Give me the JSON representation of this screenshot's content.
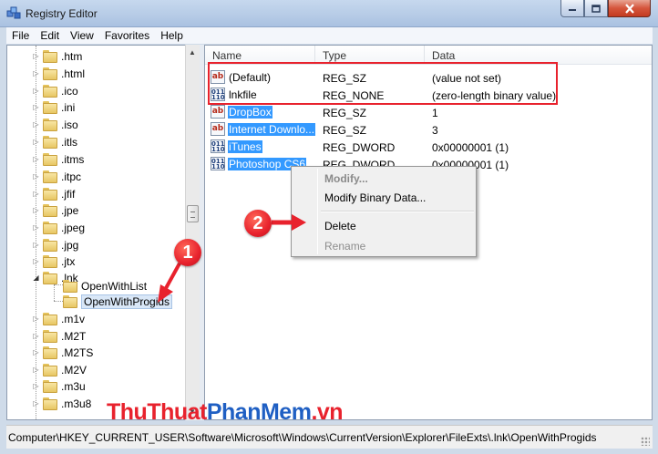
{
  "window": {
    "title": "Registry Editor"
  },
  "menu": [
    "File",
    "Edit",
    "View",
    "Favorites",
    "Help"
  ],
  "tree": {
    "items": [
      {
        "label": ".htm"
      },
      {
        "label": ".html"
      },
      {
        "label": ".ico"
      },
      {
        "label": ".ini"
      },
      {
        "label": ".iso"
      },
      {
        "label": ".itls"
      },
      {
        "label": ".itms"
      },
      {
        "label": ".itpc"
      },
      {
        "label": ".jfif"
      },
      {
        "label": ".jpe"
      },
      {
        "label": ".jpeg"
      },
      {
        "label": ".jpg"
      },
      {
        "label": ".jtx"
      },
      {
        "label": ".lnk"
      }
    ],
    "children": [
      {
        "label": "OpenWithList"
      },
      {
        "label": "OpenWithProgids"
      }
    ],
    "items_after": [
      {
        "label": ".m1v"
      },
      {
        "label": ".M2T"
      },
      {
        "label": ".M2TS"
      },
      {
        "label": ".M2V"
      },
      {
        "label": ".m3u"
      },
      {
        "label": ".m3u8"
      }
    ]
  },
  "list": {
    "headers": [
      "Name",
      "Type",
      "Data"
    ],
    "rows": [
      {
        "name": "(Default)",
        "type": "REG_SZ",
        "data": "(value not set)",
        "icon": "ab"
      },
      {
        "name": "lnkfile",
        "type": "REG_NONE",
        "data": "(zero-length binary value)",
        "icon": "bin"
      },
      {
        "name": "DropBox",
        "type": "REG_SZ",
        "data": "1",
        "icon": "ab"
      },
      {
        "name": "Internet Downlo...",
        "type": "REG_SZ",
        "data": "3",
        "icon": "ab"
      },
      {
        "name": "iTunes",
        "type": "REG_DWORD",
        "data": "0x00000001 (1)",
        "icon": "bin"
      },
      {
        "name": "Photoshop CS6",
        "type": "REG_DWORD",
        "data": "0x00000001 (1)",
        "icon": "bin"
      }
    ]
  },
  "context_menu": {
    "items": [
      "Modify...",
      "Modify Binary Data...",
      "Delete",
      "Rename"
    ]
  },
  "annotations": {
    "step1": "1",
    "step2": "2"
  },
  "watermark": {
    "part1": "ThuThuat",
    "part2": "PhanMem",
    "part3": ".vn"
  },
  "status": {
    "path": "Computer\\HKEY_CURRENT_USER\\Software\\Microsoft\\Windows\\CurrentVersion\\Explorer\\FileExts\\.lnk\\OpenWithProgids"
  },
  "colors": {
    "highlight": "#e8222d",
    "selection": "#3399ff"
  }
}
